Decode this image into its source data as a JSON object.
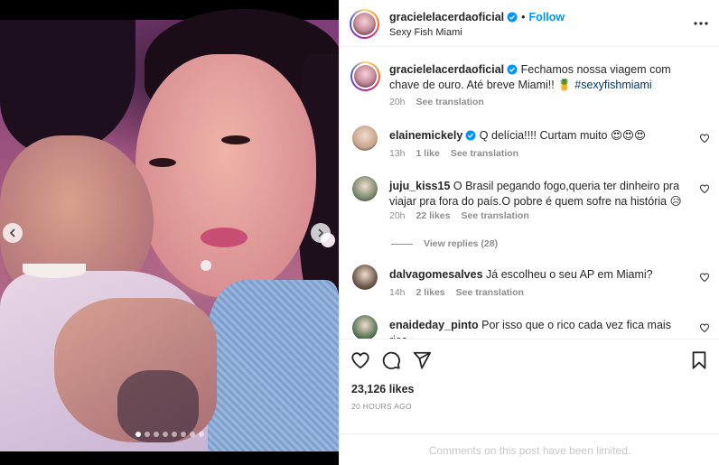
{
  "post": {
    "author": "gracielelacerdaoficial",
    "follow_label": "Follow",
    "location": "Sexy Fish Miami",
    "bullet": "•",
    "carousel": {
      "total_slides": 8,
      "active_slide": 1
    }
  },
  "caption": {
    "username": "gracielelacerdaoficial",
    "text": "Fechamos nossa viagem com chave de ouro. Até breve Miami!! 🍍 ",
    "hashtag": "#sexyfishmiami",
    "time": "20h",
    "see_translation": "See translation"
  },
  "comments": [
    {
      "username": "elainemickely",
      "verified": true,
      "text": "Q delícia!!!! Curtam muito 😍😍😍",
      "time": "13h",
      "likes": "1 like",
      "see_translation": "See translation",
      "avatar_color": "#caa48c"
    },
    {
      "username": "juju_kiss15",
      "verified": false,
      "text": "O Brasil pegando fogo,queria ter dinheiro pra viajar pra fora do país.O pobre é quem sofre na história 😥",
      "time": "20h",
      "likes": "22 likes",
      "see_translation": "See translation",
      "view_replies": "View replies (28)",
      "avatar_color": "#7a8c6e"
    },
    {
      "username": "dalvagomesalves",
      "verified": false,
      "text": "Já escolheu o seu AP em Miami?",
      "time": "14h",
      "likes": "2 likes",
      "see_translation": "See translation",
      "avatar_color": "#6e5a4c"
    },
    {
      "username": "enaideday_pinto",
      "verified": false,
      "text": "Por isso que o rico cada vez fica mais rico ,",
      "avatar_color": "#5d7a58"
    }
  ],
  "footer": {
    "likes": "23,126 likes",
    "time": "20 HOURS AGO",
    "limited": "Comments on this post have been limited."
  },
  "icons": {
    "prev": "chevron-left-icon",
    "next": "chevron-right-icon",
    "more": "more-horizontal-icon",
    "like": "heart-icon",
    "comment": "comment-icon",
    "share": "share-icon",
    "save": "bookmark-icon",
    "verified": "verified-badge-icon"
  },
  "colors": {
    "accent": "#0095f6",
    "verified": "#0095f6",
    "muted": "#8e8e8e",
    "hashtag": "#00376b"
  }
}
